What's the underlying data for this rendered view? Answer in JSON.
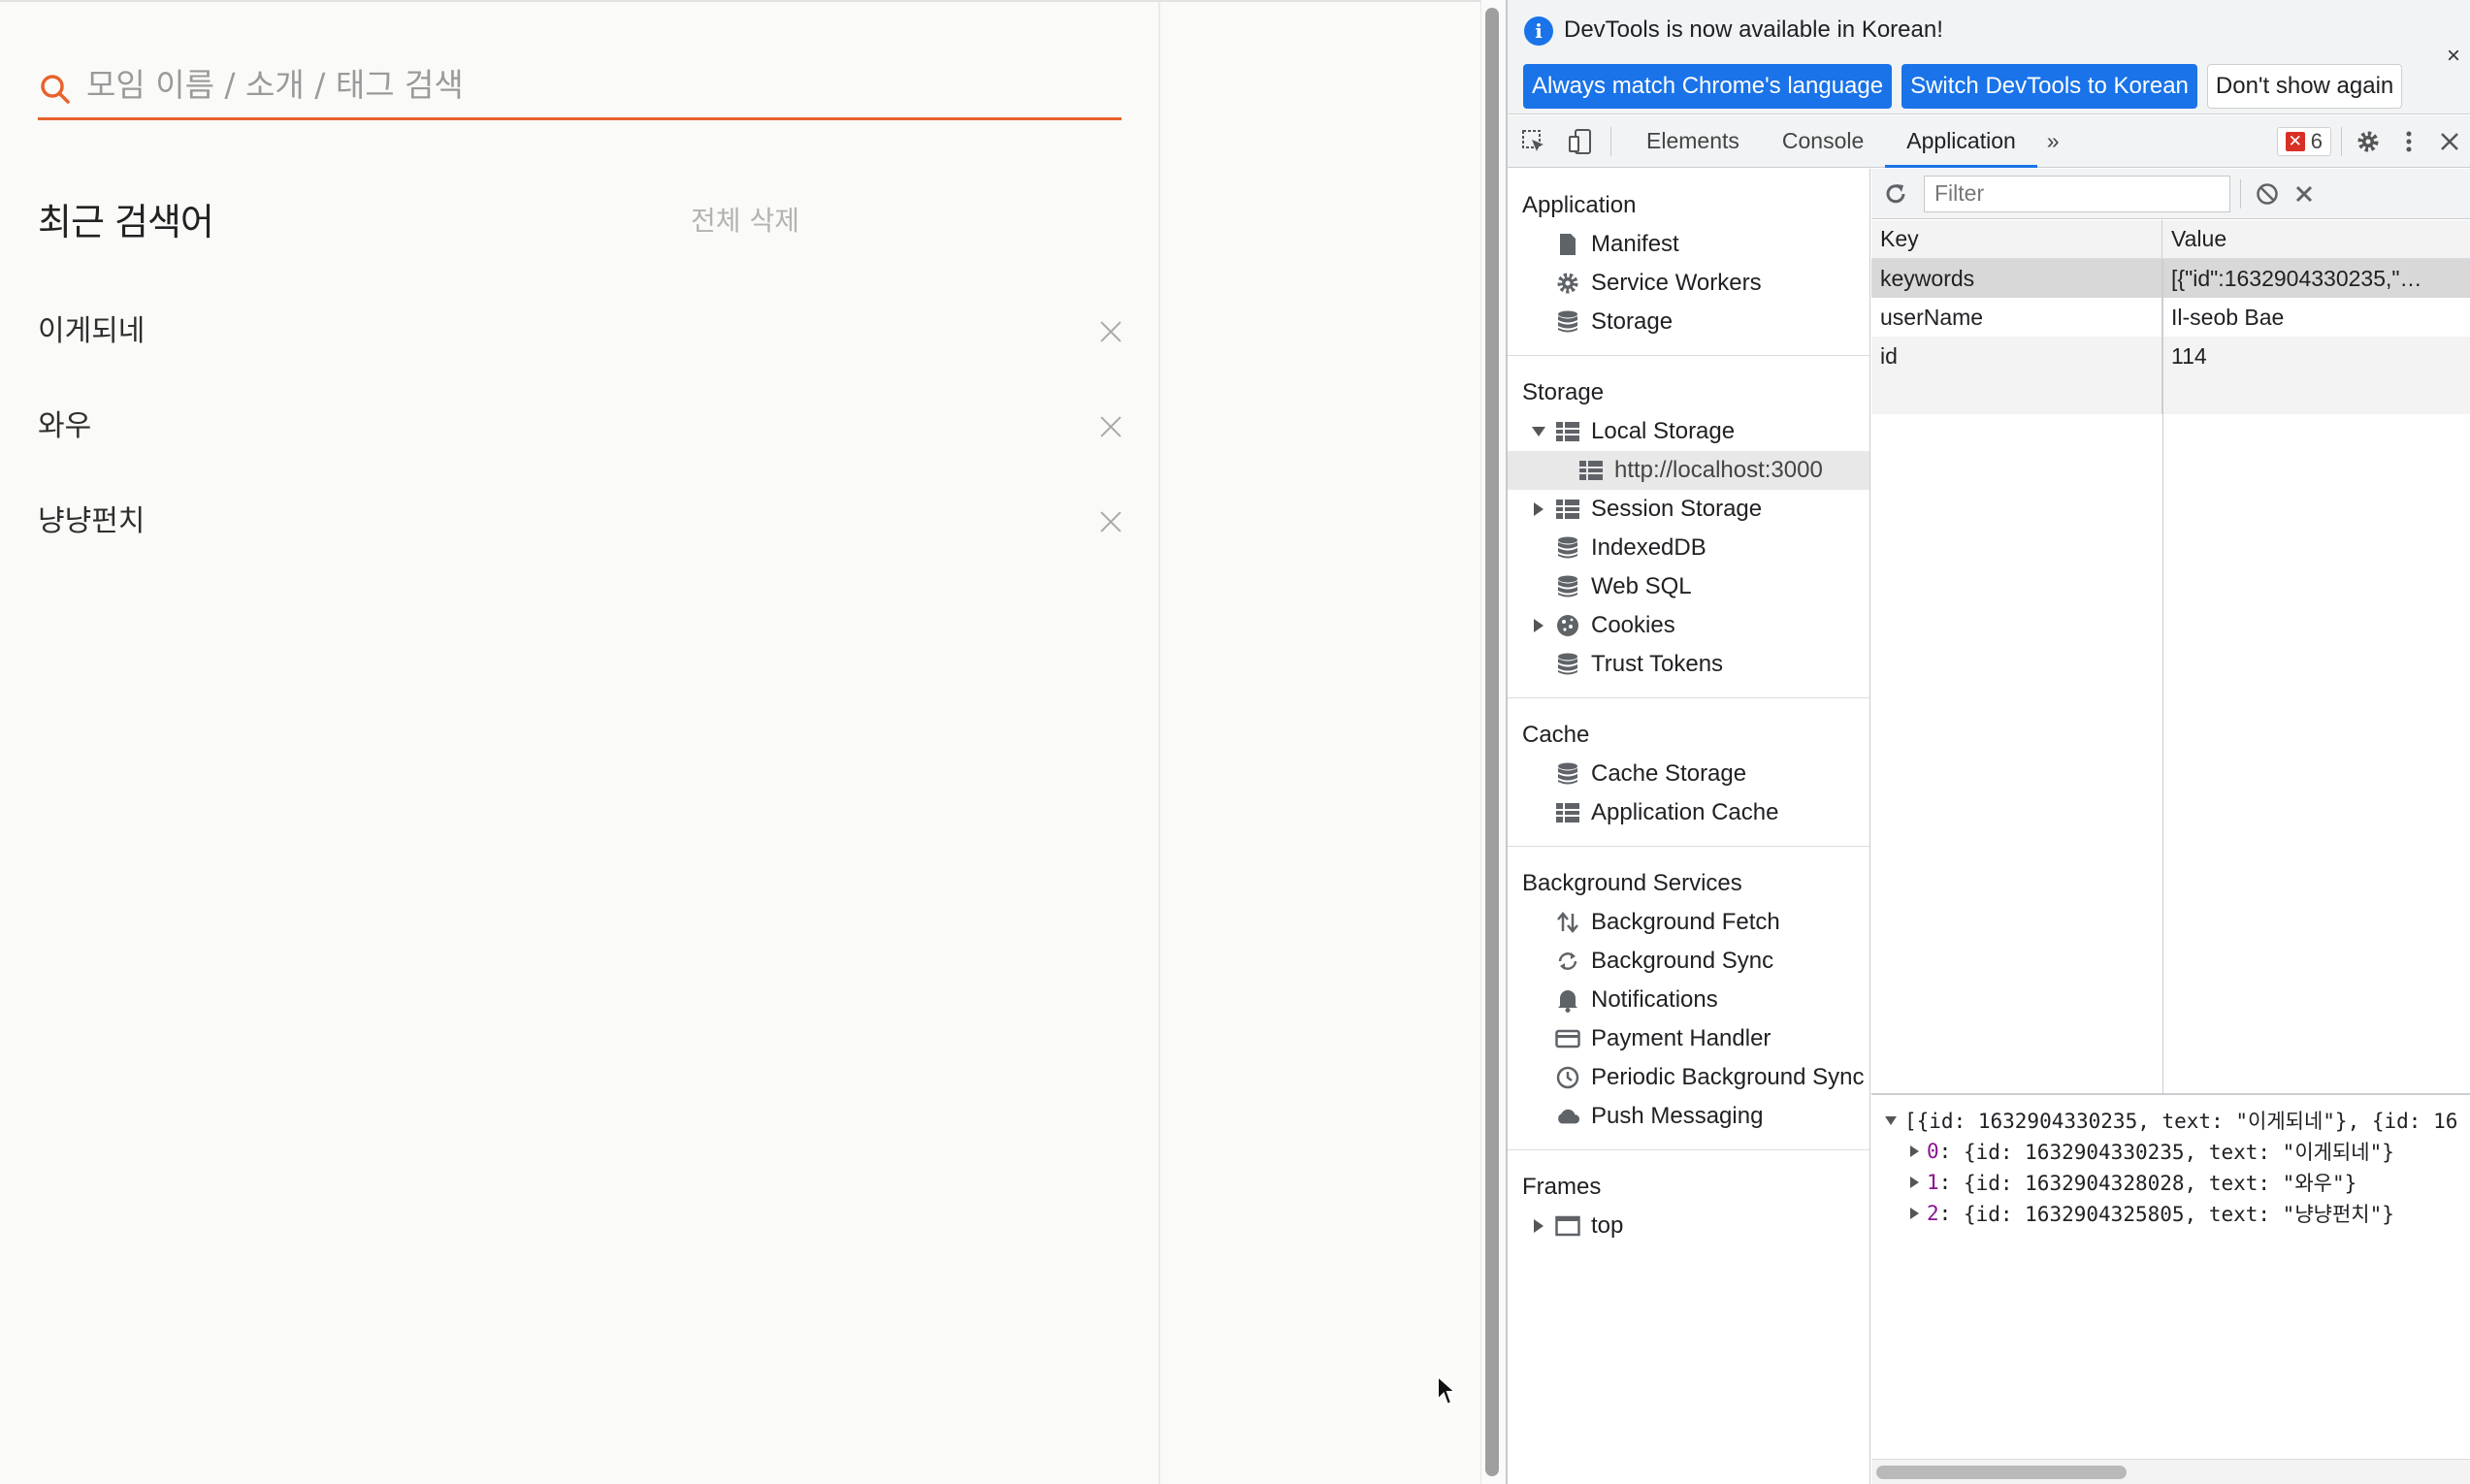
{
  "page": {
    "search": {
      "placeholder": "모임 이름 / 소개 / 태그 검색",
      "value": ""
    },
    "recent_title": "최근 검색어",
    "clear_all": "전체 삭제",
    "keywords": [
      "이게되네",
      "와우",
      "냥냥펀치"
    ],
    "accent_color": "#e8622b"
  },
  "devtools": {
    "infobar": {
      "message": "DevTools is now available in Korean!",
      "btn_match": "Always match Chrome's language",
      "btn_switch": "Switch DevTools to Korean",
      "btn_dont_show": "Don't show again",
      "close": "×"
    },
    "tabs": [
      "Elements",
      "Console",
      "Application"
    ],
    "active_tab": "Application",
    "more_tabs": "»",
    "error_count": "6",
    "sidebar": {
      "application": {
        "title": "Application",
        "items": [
          "Manifest",
          "Service Workers",
          "Storage"
        ]
      },
      "storage": {
        "title": "Storage",
        "local_storage": "Local Storage",
        "local_origin": "http://localhost:3000",
        "session_storage": "Session Storage",
        "indexeddb": "IndexedDB",
        "websql": "Web SQL",
        "cookies": "Cookies",
        "trust_tokens": "Trust Tokens"
      },
      "cache": {
        "title": "Cache",
        "items": [
          "Cache Storage",
          "Application Cache"
        ]
      },
      "background": {
        "title": "Background Services",
        "items": [
          "Background Fetch",
          "Background Sync",
          "Notifications",
          "Payment Handler",
          "Periodic Background Sync",
          "Push Messaging"
        ]
      },
      "frames": {
        "title": "Frames",
        "top": "top"
      }
    },
    "filter": {
      "placeholder": "Filter"
    },
    "grid": {
      "headers": {
        "key": "Key",
        "value": "Value"
      },
      "rows": [
        {
          "key": "keywords",
          "value": "[{\"id\":1632904330235,\"…"
        },
        {
          "key": "userName",
          "value": "Il-seob Bae"
        },
        {
          "key": "id",
          "value": "114"
        }
      ]
    },
    "preview": {
      "root": "[{id: 1632904330235, text: \"이게되네\"}, {id: 16",
      "items": [
        {
          "idx": "0",
          "text": "{id: 1632904330235, text: \"이게되네\"}"
        },
        {
          "idx": "1",
          "text": "{id: 1632904328028, text: \"와우\"}"
        },
        {
          "idx": "2",
          "text": "{id: 1632904325805, text: \"냥냥펀치\"}"
        }
      ]
    }
  }
}
